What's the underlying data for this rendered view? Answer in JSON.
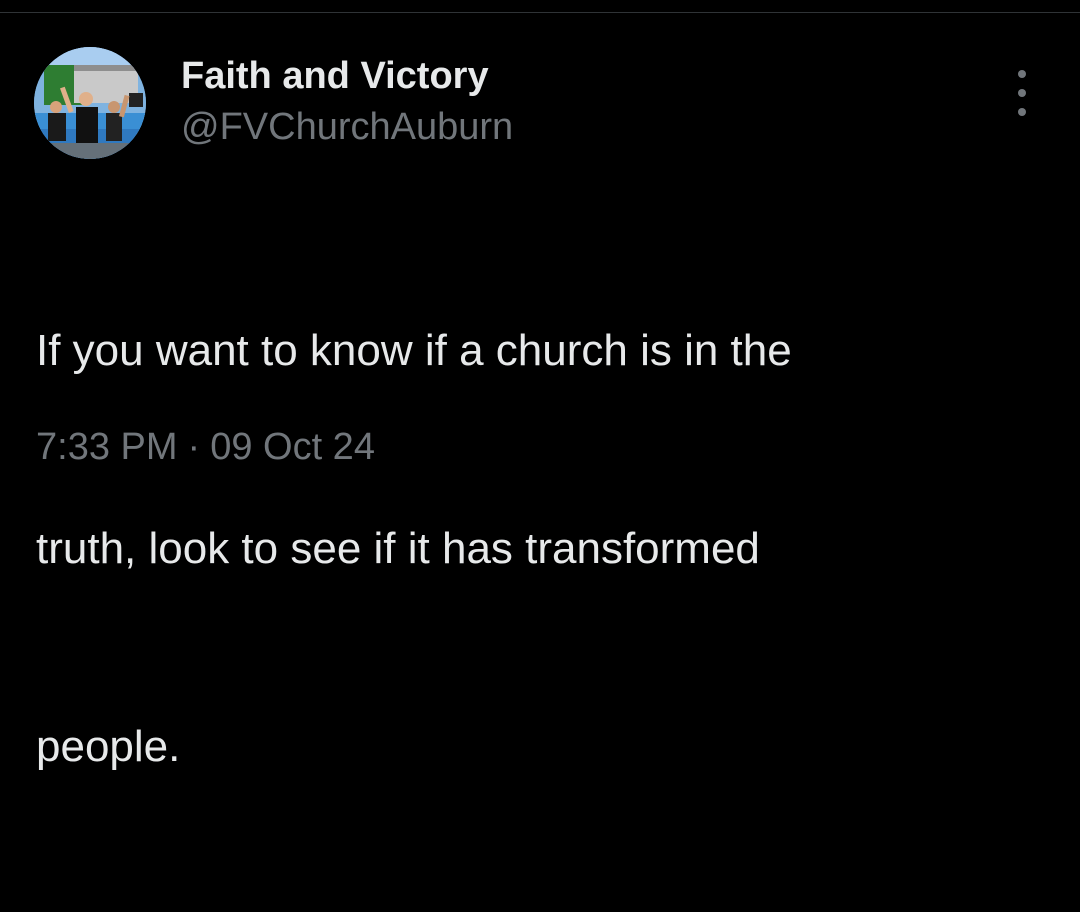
{
  "tweet": {
    "author": {
      "display_name": "Faith and Victory",
      "handle": "@FVChurchAuburn",
      "avatar": "church-baptism-photo"
    },
    "text_lines": [
      "If you want to know if a church is in the",
      "truth, look to see if it has transformed",
      "people."
    ],
    "time": "7:33 PM",
    "separator": "·",
    "date": "09 Oct 24",
    "more_icon": "more-options-icon"
  },
  "colors": {
    "background": "#000000",
    "primary_text": "#e7e9ea",
    "secondary_text": "#71767b",
    "divider": "#2f3336"
  }
}
